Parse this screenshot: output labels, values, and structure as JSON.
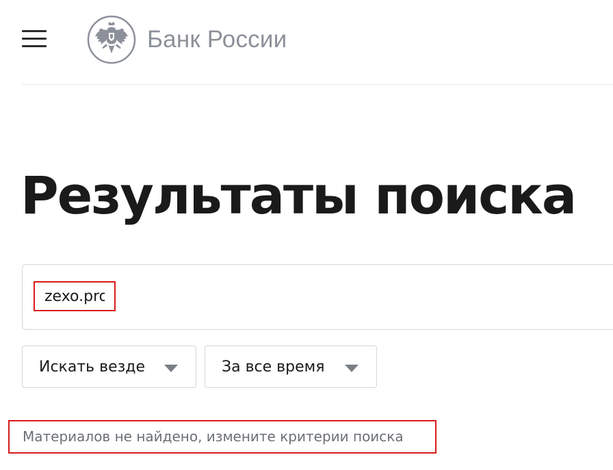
{
  "header": {
    "logo_text": "Банк России",
    "logo_icon": "double-headed-eagle-emblem",
    "menu_icon": "hamburger-menu-icon"
  },
  "page": {
    "title": "Результаты поиска"
  },
  "search": {
    "value": "zexo.pro",
    "placeholder": ""
  },
  "filters": {
    "where": {
      "selected": "Искать везде"
    },
    "time": {
      "selected": "За все время"
    }
  },
  "results": {
    "message": "Материалов не найдено, измените критерии поиска"
  },
  "colors": {
    "highlight": "#d91a1a",
    "logo_gray": "#8c9099",
    "text": "#1a1a1a",
    "muted_text": "#6b6f76"
  }
}
